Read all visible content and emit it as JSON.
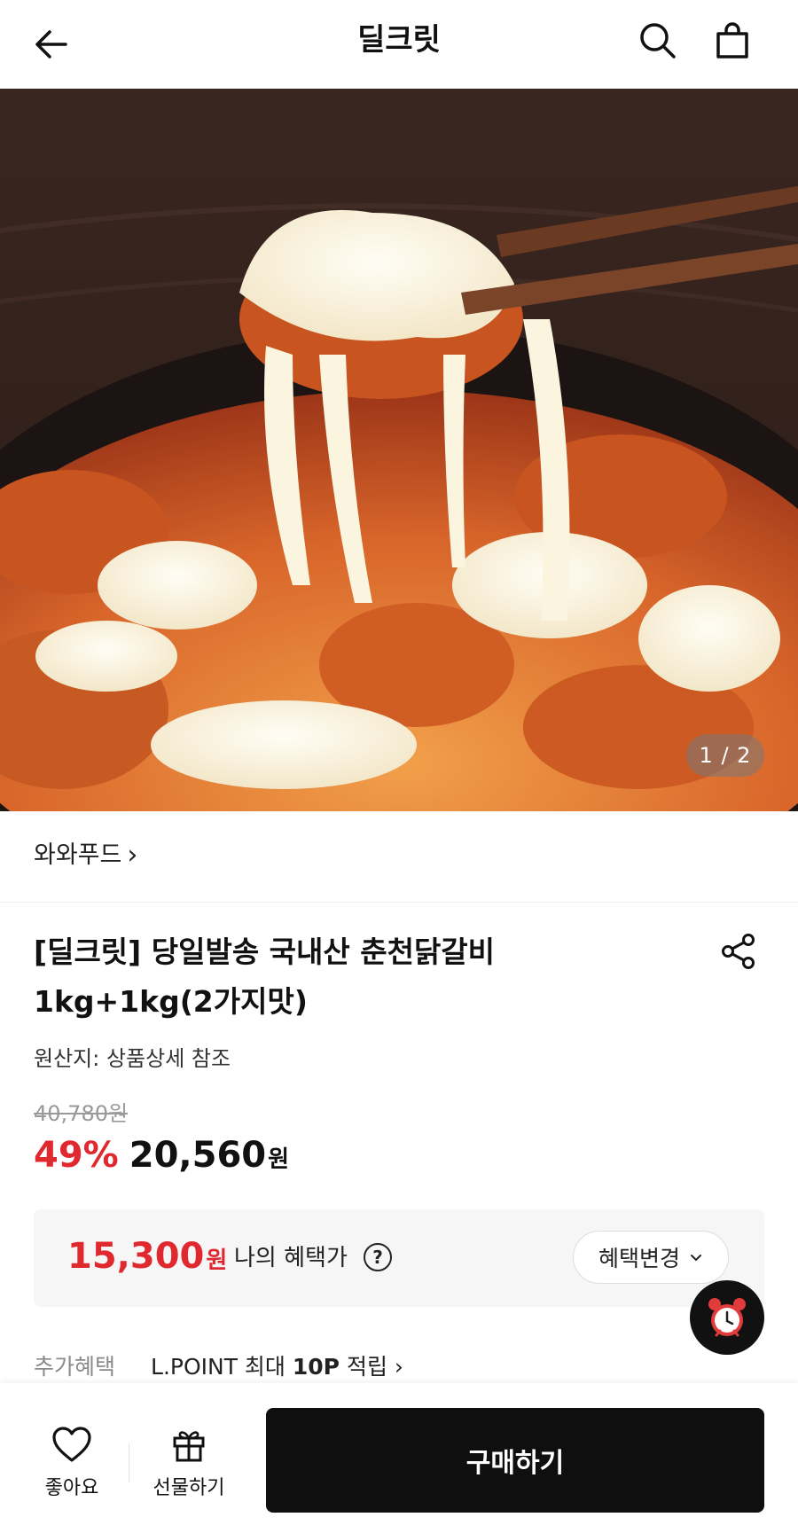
{
  "header": {
    "title": "딜크릿",
    "back_icon": "arrow-left-icon",
    "search_icon": "search-icon",
    "bag_icon": "shopping-bag-icon"
  },
  "hero": {
    "alt": "치즈가 늘어나는 춘천닭갈비 사진",
    "page_indicator": "1 / 2"
  },
  "seller": {
    "name": "와와푸드",
    "arrow": "›"
  },
  "product": {
    "title_line1": "[딜크릿] 당일발송 국내산 춘천닭갈비",
    "title_line2": "1kg+1kg(2가지맛)",
    "origin": "원산지: 상품상세 참조",
    "original_price": "40,780원",
    "discount_rate": "49%",
    "sale_price": "20,560",
    "sale_unit": "원",
    "share_icon": "share-icon"
  },
  "benefit": {
    "price": "15,300",
    "unit": "원",
    "label": "나의 혜택가",
    "help": "?",
    "change_label": "혜택변경",
    "change_chevron": "⌄"
  },
  "extra": {
    "label": "추가혜택",
    "text_prefix": "L.POINT 최대 ",
    "text_bold": "10P",
    "text_suffix": " 적립 ›"
  },
  "bottom": {
    "like_label": "좋아요",
    "gift_label": "선물하기",
    "buy_label": "구매하기"
  },
  "colors": {
    "accent_red": "#e0282f",
    "buy_button": "#0f0f0f",
    "benefit_bg": "#f6f6f6"
  }
}
